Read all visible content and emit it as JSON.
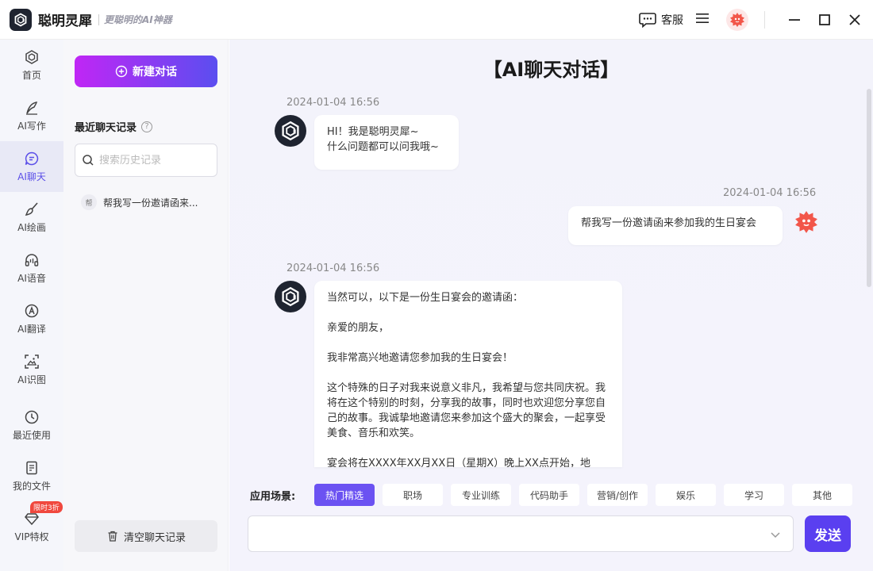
{
  "app": {
    "name": "聪明灵犀",
    "slogan": "更聪明的AI神器"
  },
  "titlebar": {
    "service_label": "客服"
  },
  "nav": {
    "items": [
      {
        "label": "首页",
        "icon": "home-icon"
      },
      {
        "label": "AI写作",
        "icon": "pen-icon"
      },
      {
        "label": "AI聊天",
        "icon": "chat-icon",
        "active": true
      },
      {
        "label": "AI绘画",
        "icon": "brush-icon"
      },
      {
        "label": "AI语音",
        "icon": "headphones-icon"
      },
      {
        "label": "AI翻译",
        "icon": "translate-icon"
      },
      {
        "label": "AI识图",
        "icon": "image-scan-icon"
      },
      {
        "label": "最近使用",
        "icon": "history-icon"
      },
      {
        "label": "我的文件",
        "icon": "file-icon"
      },
      {
        "label": "VIP特权",
        "icon": "diamond-icon",
        "badge": "限时3折"
      }
    ]
  },
  "sidebar": {
    "new_chat_label": "新建对话",
    "recent_title": "最近聊天记录",
    "help_glyph": "?",
    "search_placeholder": "搜索历史记录",
    "history": [
      {
        "tag": "帮",
        "text": "帮我写一份邀请函来..."
      }
    ],
    "clear_label": "清空聊天记录"
  },
  "chat": {
    "title": "【AI聊天对话】",
    "messages": [
      {
        "role": "bot",
        "time": "2024-01-04 16:56",
        "lines": [
          "HI！我是聪明灵犀~",
          "什么问题都可以问我哦~"
        ]
      },
      {
        "role": "user",
        "time": "2024-01-04 16:56",
        "text": "帮我写一份邀请函来参加我的生日宴会"
      },
      {
        "role": "bot",
        "time": "2024-01-04 16:56",
        "paragraphs": [
          "当然可以，以下是一份生日宴会的邀请函：",
          "亲爱的朋友，",
          "我非常高兴地邀请您参加我的生日宴会！",
          "这个特殊的日子对我来说意义非凡，我希望与您共同庆祝。我将在这个特别的时刻，分享我的故事，同时也欢迎您分享您自己的故事。我诚挚地邀请您来参加这个盛大的聚会，一起享受美食、音乐和欢笑。",
          "宴会将在XXXX年XX月XX日（星期X）晚上XX点开始，地"
        ]
      }
    ]
  },
  "scenes": {
    "label": "应用场景:",
    "chips": [
      "热门精选",
      "职场",
      "专业训练",
      "代码助手",
      "营销/创作",
      "娱乐",
      "学习",
      "其他"
    ],
    "active_index": 0
  },
  "composer": {
    "value": "",
    "send_label": "发送"
  },
  "colors": {
    "accent": "#5a3ff0",
    "gradient_start": "#c026f5",
    "gradient_end": "#5b4ef0",
    "active_chip": "#6b52f2"
  }
}
